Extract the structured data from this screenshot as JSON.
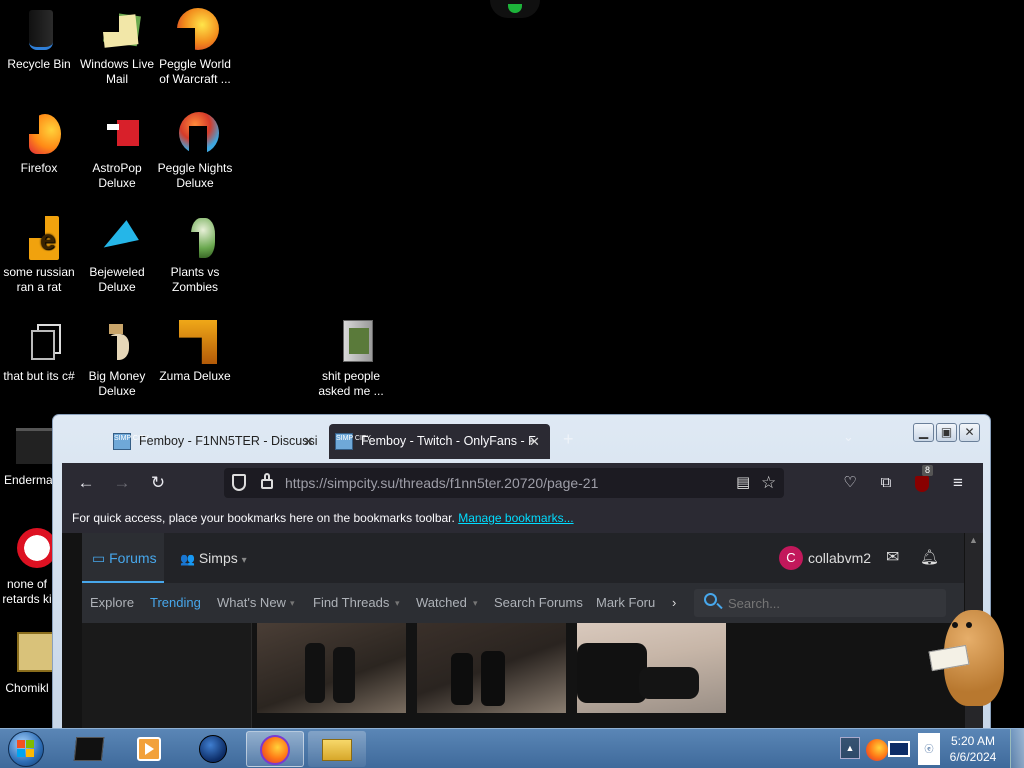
{
  "desktop_icons": [
    {
      "label": "Recycle Bin",
      "icon": "recycle-bin-icon"
    },
    {
      "label": "Windows Live Mail",
      "icon": "mail-icon"
    },
    {
      "label": "Peggle World of Warcraft ...",
      "icon": "peggle-icon"
    },
    {
      "label": "Firefox",
      "icon": "firefox-icon"
    },
    {
      "label": "AstroPop Deluxe",
      "icon": "astropop-icon"
    },
    {
      "label": "Peggle Nights Deluxe",
      "icon": "peggle-nights-icon"
    },
    {
      "label": "some russian ran a rat",
      "icon": "app-icon"
    },
    {
      "label": "Bejeweled Deluxe",
      "icon": "gem-icon"
    },
    {
      "label": "Plants vs Zombies",
      "icon": "plant-icon"
    },
    {
      "label": "that but its c#",
      "icon": "app-icon"
    },
    {
      "label": "Big Money Deluxe",
      "icon": "money-bag-icon"
    },
    {
      "label": "Zuma Deluxe",
      "icon": "zuma-icon"
    },
    {
      "label": "shit people asked me ...",
      "icon": "folder-icon"
    },
    {
      "label": "Enderma",
      "icon": "app-icon"
    },
    {
      "label": "none of retards ki",
      "icon": "app-icon"
    },
    {
      "label": "Chomikl",
      "icon": "app-icon"
    }
  ],
  "browser": {
    "tabs": [
      {
        "title": "Femboy - F1NN5TER - Discussi",
        "favicon": "SIMP CITY",
        "active": false
      },
      {
        "title": "Femboy - Twitch - OnlyFans - F",
        "favicon": "SIMP CITY",
        "active": true
      }
    ],
    "new_tab_label": "+",
    "url_host": "https://simpcity.su",
    "url_path": "/threads/f1nn5ter.20720/page-21",
    "extension_badge": "8",
    "bookmarks_text": "For quick access, place your bookmarks here on the bookmarks toolbar.",
    "bookmarks_link": "Manage bookmarks...",
    "forum": {
      "forums_label": "Forums",
      "simps_label": "Simps",
      "user_initial": "C",
      "username": "collabvm2",
      "subnav": [
        "Explore",
        "Trending",
        "What's New",
        "Find Threads",
        "Watched",
        "Search Forums",
        "Mark Foru"
      ],
      "search_placeholder": "Search..."
    }
  },
  "taskbar": {
    "time": "5:20 AM",
    "date": "6/6/2024"
  },
  "colors": {
    "accent_cyan": "#00ddff",
    "forum_accent": "#47a7eb",
    "trending": "#47a7eb",
    "avatar": "#c2185b"
  }
}
